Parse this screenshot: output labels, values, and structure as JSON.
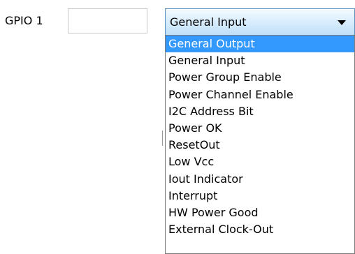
{
  "gpio": {
    "label": "GPIO 1",
    "value": ""
  },
  "select": {
    "selected_value": "General Input",
    "arrow_icon": "triangle-down"
  },
  "dropdown": {
    "highlighted_index": 0,
    "highlight_color": "#3399ff",
    "options": [
      "General Output",
      "General Input",
      "Power Group Enable",
      "Power Channel Enable",
      "I2C Address Bit",
      "Power OK",
      "ResetOut",
      "Low Vcc",
      "Iout Indicator",
      "Interrupt",
      "HW Power Good",
      "External Clock-Out"
    ]
  }
}
